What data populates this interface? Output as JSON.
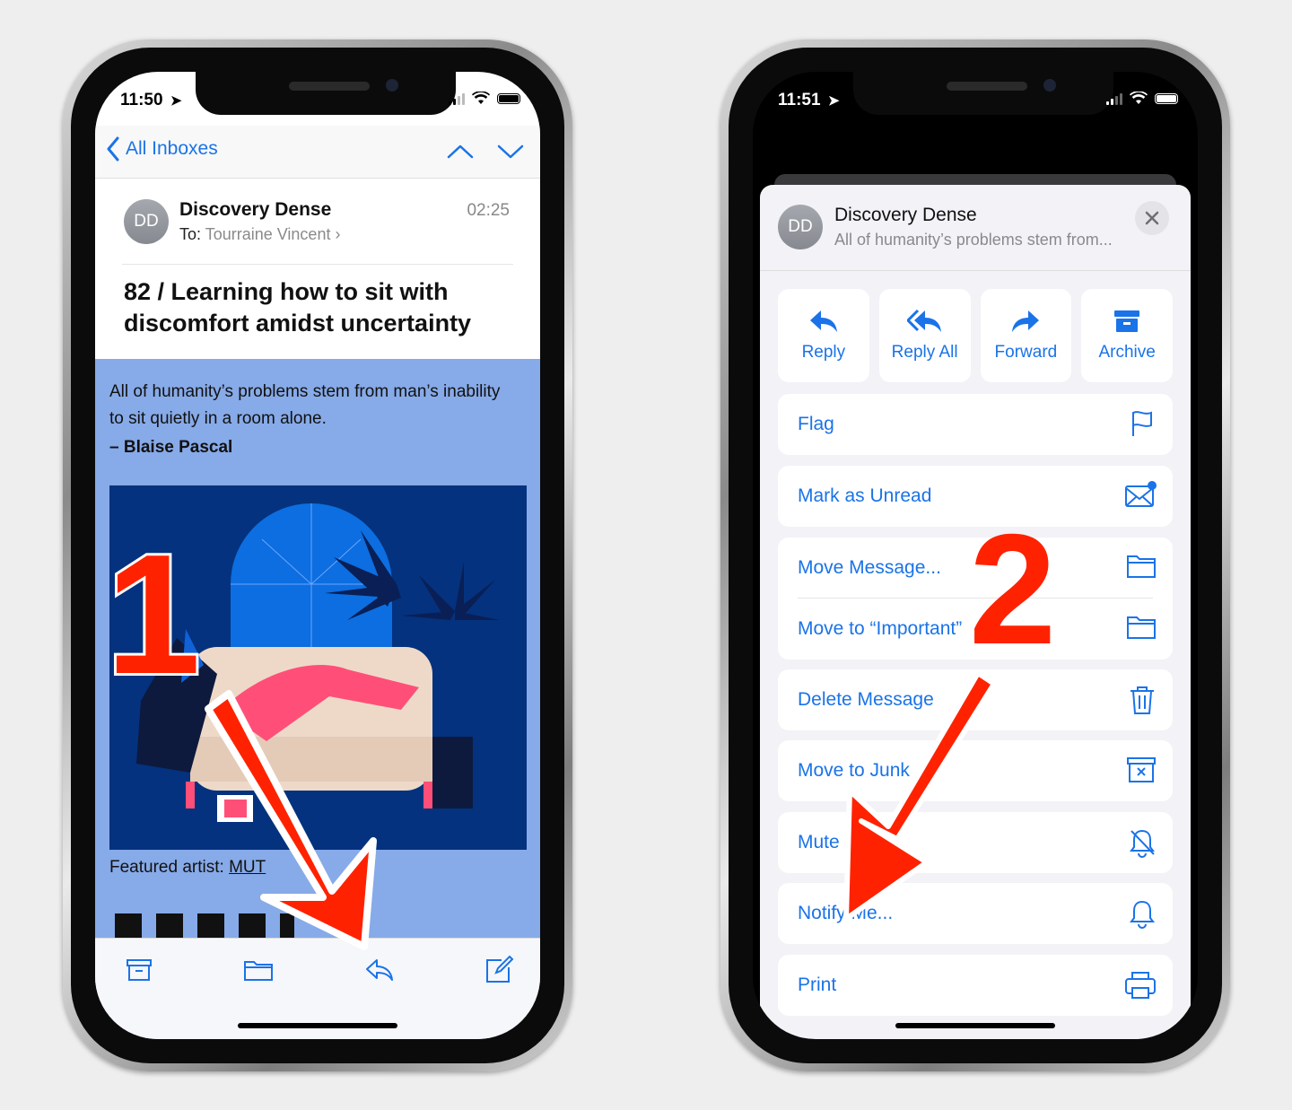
{
  "colors": {
    "ios_blue": "#1a73e8",
    "annotation_red": "#ff2200",
    "art_blue": "#04327e",
    "email_bg": "#87aae8"
  },
  "screen1": {
    "status_time": "11:50",
    "back_label": "All Inboxes",
    "avatar_initials": "DD",
    "sender": "Discovery Dense",
    "received_time": "02:25",
    "to_label": "To:",
    "to_value": "Tourraine Vincent",
    "subject": "82 / Learning how to sit with discomfort amidst uncertainty",
    "quote": "All of humanity’s problems stem from man’s inability to sit quietly in a room alone.",
    "quote_author": "– Blaise Pascal",
    "featured_prefix": "Featured artist: ",
    "featured_link": "MUT",
    "toolbar_icons": [
      "archive-icon",
      "folder-icon",
      "reply-icon",
      "compose-icon"
    ]
  },
  "screen2": {
    "status_time": "11:51",
    "avatar_initials": "DD",
    "sender": "Discovery Dense",
    "preview": "All of humanity’s problems stem from...",
    "quick_actions": [
      "Reply",
      "Reply All",
      "Forward",
      "Archive"
    ],
    "actions": {
      "flag": "Flag",
      "mark_unread": "Mark as Unread",
      "move_message": "Move Message...",
      "move_important": "Move to “Important”",
      "delete": "Delete Message",
      "junk": "Move to Junk",
      "mute": "Mute",
      "notify": "Notify Me...",
      "print": "Print"
    }
  },
  "annotations": {
    "step1": "1",
    "step2": "2"
  }
}
